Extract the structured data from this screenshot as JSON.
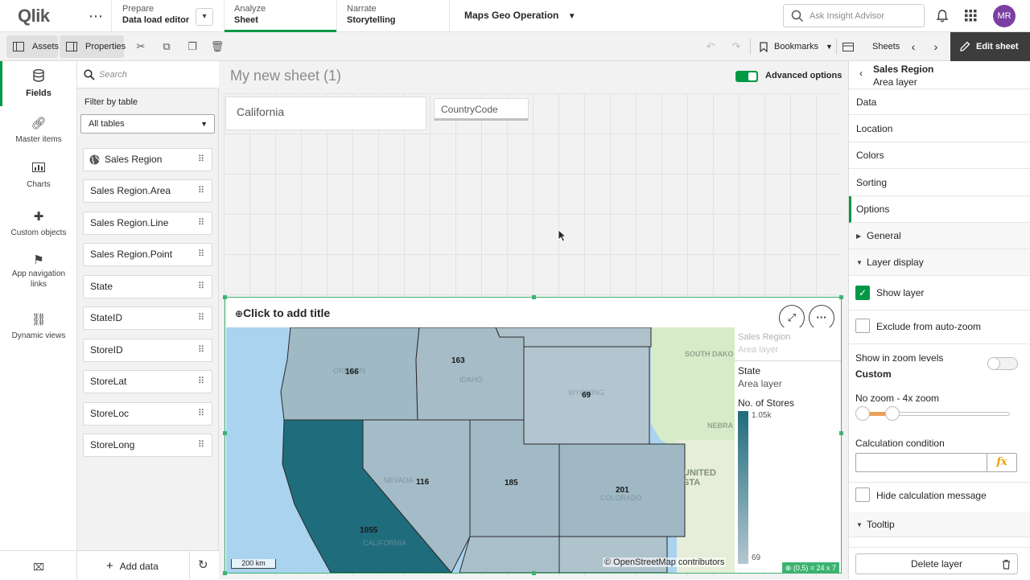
{
  "header": {
    "logo": "Qlik",
    "nav": [
      {
        "top": "Prepare",
        "bottom": "Data load editor"
      },
      {
        "top": "Analyze",
        "bottom": "Sheet"
      },
      {
        "top": "Narrate",
        "bottom": "Storytelling"
      }
    ],
    "app_name": "Maps Geo Operation",
    "search_placeholder": "Ask Insight Advisor",
    "avatar_initials": "MR"
  },
  "toolbar": {
    "assets": "Assets",
    "properties": "Properties",
    "bookmarks": "Bookmarks",
    "sheets": "Sheets",
    "edit_sheet": "Edit sheet"
  },
  "rail": [
    {
      "label": "Fields",
      "icon": "database-icon"
    },
    {
      "label": "Master items",
      "icon": "link-icon"
    },
    {
      "label": "Charts",
      "icon": "bar-chart-icon"
    },
    {
      "label": "Custom objects",
      "icon": "puzzle-icon"
    },
    {
      "label": "App navigation links",
      "icon": "signpost-icon"
    },
    {
      "label": "Dynamic views",
      "icon": "dynamic-views-icon"
    }
  ],
  "fields_panel": {
    "search_placeholder": "Search",
    "filter_label": "Filter by table",
    "filter_value": "All tables",
    "items": [
      "Sales Region",
      "Sales Region.Area",
      "Sales Region.Line",
      "Sales Region.Point",
      "State",
      "StateID",
      "StoreID",
      "StoreLat",
      "StoreLoc",
      "StoreLong"
    ],
    "add_data": "Add data"
  },
  "sheet": {
    "title": "My new sheet (1)",
    "advanced_options": "Advanced options",
    "filter1": "California",
    "filter2": "CountryCode"
  },
  "map": {
    "title": "Click to add title",
    "values": {
      "oregon": "166",
      "idaho": "163",
      "wyoming": "69",
      "nevada": "116",
      "utah": "185",
      "colorado": "201",
      "california": "1055"
    },
    "state_labels": {
      "idaho": "IDAHO",
      "wyoming": "WYOMING",
      "colorado": "COLORADO",
      "california": "CALIFORNIA",
      "oregon": "OREGON",
      "nevada": "NEVADA"
    },
    "bg_labels": {
      "south_dakota": "SOUTH DAKO",
      "nebraska": "NEBRA",
      "united_states": "UNITED STA"
    },
    "scale": "200 km",
    "attribution": "© OpenStreetMap contributors",
    "status": "⊕ (0,5)  ⌗ 24 x 7",
    "legend": {
      "layer1_name": "Sales Region",
      "layer1_type": "Area layer",
      "layer2_name": "State",
      "layer2_type": "Area layer",
      "measure": "No. of Stores",
      "max": "1.05k",
      "min": "69"
    },
    "colors": {
      "high": "#1f6c7c",
      "low": "#b3c6d0"
    }
  },
  "properties": {
    "header_title": "Sales Region",
    "header_sub": "Area layer",
    "sections": [
      "Data",
      "Location",
      "Colors",
      "Sorting",
      "Options"
    ],
    "general": "General",
    "layer_display": "Layer display",
    "show_layer": "Show layer",
    "exclude_autozoom": "Exclude from auto-zoom",
    "zoom_levels": "Show in zoom levels",
    "zoom_mode": "Custom",
    "zoom_range": "No zoom - 4x zoom",
    "calc_condition": "Calculation condition",
    "fx": "fx",
    "hide_calc_msg": "Hide calculation message",
    "tooltip": "Tooltip",
    "delete_layer": "Delete layer"
  }
}
